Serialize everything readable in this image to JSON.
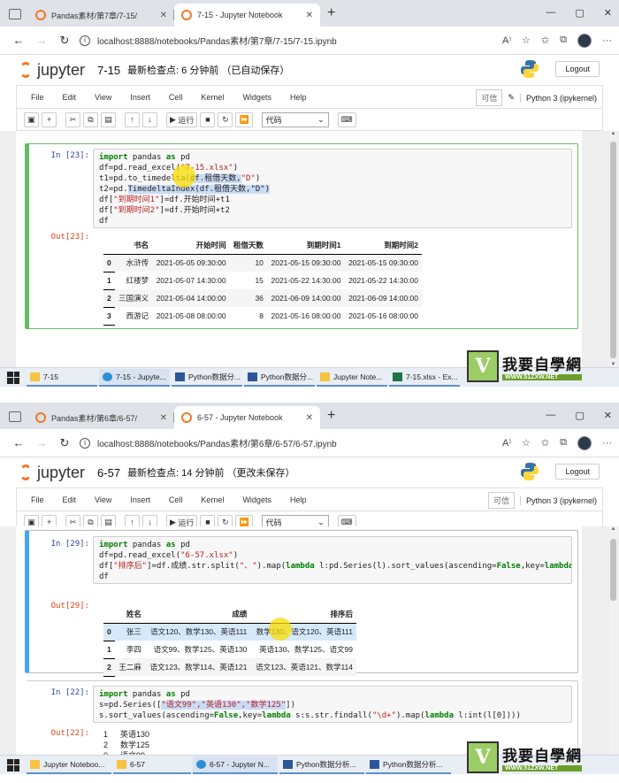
{
  "screens": [
    {
      "tabs": [
        {
          "label": "Pandas素材/第7章/7-15/",
          "active": false
        },
        {
          "label": "7-15 - Jupyter Notebook",
          "active": true
        }
      ],
      "url": "localhost:8888/notebooks/Pandas素材/第7章/7-15/7-15.ipynb",
      "notebook_title": "7-15",
      "checkpoint": "最新检查点: 6 分钟前 （已自动保存）",
      "cells": [
        {
          "in_prompt": "In [23]:",
          "code": [
            [
              [
                "import",
                "kw"
              ],
              [
                " pandas ",
                ""
              ],
              [
                "as",
                "kw"
              ],
              [
                " pd",
                ""
              ]
            ],
            [
              [
                "df=pd.read_excel(",
                ""
              ],
              [
                "\"7-15.xlsx\"",
                "str"
              ],
              [
                ")",
                ""
              ]
            ],
            [
              [
                "t1=pd.to_timedelta(",
                ""
              ],
              [
                "df.租借天数,",
                "hl"
              ],
              [
                "\"D\"",
                "str"
              ],
              [
                ")",
                ""
              ]
            ],
            [
              [
                "t2=pd.",
                ""
              ],
              [
                "TimedeltaIndex(df.租借天数,\"D\")",
                "hl"
              ]
            ],
            [
              [
                "df[",
                ""
              ],
              [
                "\"到期时间1\"",
                "str"
              ],
              [
                "]=df.开始时间+t1",
                ""
              ]
            ],
            [
              [
                "df[",
                ""
              ],
              [
                "\"到期时间2\"",
                "str"
              ],
              [
                "]=df.开始时间+t2",
                ""
              ]
            ],
            [
              [
                "df",
                ""
              ]
            ]
          ],
          "out_prompt": "Out[23]:",
          "table": {
            "columns": [
              "",
              "书名",
              "开始时间",
              "租借天数",
              "到期时间1",
              "到期时间2"
            ],
            "rows": [
              [
                "0",
                "水浒传",
                "2021-05-05 09:30:00",
                "10",
                "2021-05-15 09:30:00",
                "2021-05-15 09:30:00"
              ],
              [
                "1",
                "红楼梦",
                "2021-05-07 14:30:00",
                "15",
                "2021-05-22 14:30:00",
                "2021-05-22 14:30:00"
              ],
              [
                "2",
                "三国演义",
                "2021-05-04 14:00:00",
                "36",
                "2021-06-09 14:00:00",
                "2021-06-09 14:00:00"
              ],
              [
                "3",
                "西游记",
                "2021-05-08 08:00:00",
                "8",
                "2021-05-16 08:00:00",
                "2021-05-16 08:00:00"
              ]
            ]
          }
        }
      ],
      "taskbar": [
        "7-15",
        "7-15 - Jupyte...",
        "Python数据分...",
        "Python数据分...",
        "Jupyter Note...",
        "7-15.xlsx - Ex..."
      ]
    },
    {
      "tabs": [
        {
          "label": "Pandas素材/第6章/6-57/",
          "active": false
        },
        {
          "label": "6-57 - Jupyter Notebook",
          "active": true
        }
      ],
      "url": "localhost:8888/notebooks/Pandas素材/第6章/6-57/6-57.ipynb",
      "notebook_title": "6-57",
      "checkpoint": "最新检查点: 14 分钟前 （更改未保存）",
      "cells": [
        {
          "in_prompt": "In [29]:",
          "code": [
            [
              [
                "import",
                "kw"
              ],
              [
                " pandas ",
                ""
              ],
              [
                "as",
                "kw"
              ],
              [
                " pd",
                ""
              ]
            ],
            [
              [
                "df=pd.read_excel(",
                ""
              ],
              [
                "\"6-57.xlsx\"",
                "str"
              ],
              [
                ")",
                ""
              ]
            ],
            [
              [
                "df[",
                ""
              ],
              [
                "\"排序后\"",
                "str"
              ],
              [
                "]=df.成绩.str.split(",
                ""
              ],
              [
                "\"、\"",
                "str"
              ],
              [
                ").map(",
                ""
              ],
              [
                "lambda",
                "kw"
              ],
              [
                " l:pd.Series(l).sort_values(ascending=",
                ""
              ],
              [
                "False",
                "kw"
              ],
              [
                ",key=",
                ""
              ],
              [
                "lambda",
                "kw"
              ],
              [
                " s:s.str.find",
                ""
              ]
            ],
            [
              [
                "df",
                ""
              ]
            ]
          ],
          "out_prompt": "Out[29]:",
          "table": {
            "columns": [
              "",
              "姓名",
              "成绩",
              "排序后"
            ],
            "rows": [
              [
                "0",
                "张三",
                "语文120、数学130、英语111",
                "数学130、语文120、英语111"
              ],
              [
                "1",
                "李四",
                "语文99、数学125、英语130",
                "英语130、数学125、语文99"
              ],
              [
                "2",
                "王二麻",
                "语文123、数学114、英语121",
                "语文123、英语121、数学114"
              ]
            ]
          }
        },
        {
          "in_prompt": "In [22]:",
          "code": [
            [
              [
                "import",
                "kw"
              ],
              [
                " pandas ",
                ""
              ],
              [
                "as",
                "kw"
              ],
              [
                " pd",
                ""
              ]
            ],
            [
              [
                "s=pd.Series([",
                ""
              ],
              [
                "\"语文99\",\"英语130\",\"数学125\"",
                "str hl"
              ],
              [
                "])",
                ""
              ]
            ],
            [
              [
                "s.sort_values(ascending=",
                ""
              ],
              [
                "False",
                "kw"
              ],
              [
                ",key=",
                ""
              ],
              [
                "lambda",
                "kw"
              ],
              [
                " s:s.str.findall(",
                ""
              ],
              [
                "\"\\d+\"",
                "str"
              ],
              [
                ").map(",
                ""
              ],
              [
                "lambda",
                "kw"
              ],
              [
                " l:int(l[0])))",
                ""
              ]
            ]
          ],
          "out_prompt": "Out[22]:",
          "series": [
            [
              "1",
              "英语130"
            ],
            [
              "2",
              "数学125"
            ],
            [
              "0",
              "语文99"
            ]
          ]
        }
      ],
      "taskbar": [
        "Jupyter Noteboo...",
        "6-57",
        "6-57 - Jupyter N...",
        "Python数据分析...",
        "Python数据分析..."
      ]
    }
  ],
  "menu": [
    "File",
    "Edit",
    "View",
    "Insert",
    "Cell",
    "Kernel",
    "Widgets",
    "Help"
  ],
  "trusted": "可信",
  "kernel": "Python 3 (ipykernel)",
  "logout": "Logout",
  "jupyter_word": "jupyter",
  "run_label": "运行",
  "cell_type": "代码",
  "watermark": {
    "cn": "我要自學網",
    "url": "WWW.51ZXW.NET",
    "logo_char": "V"
  },
  "colors": {
    "accent": "#f37726",
    "edit_border": "#66bb6a",
    "select_border": "#42a5f5",
    "in_prompt": "#303f9f",
    "out_prompt": "#d84315"
  }
}
